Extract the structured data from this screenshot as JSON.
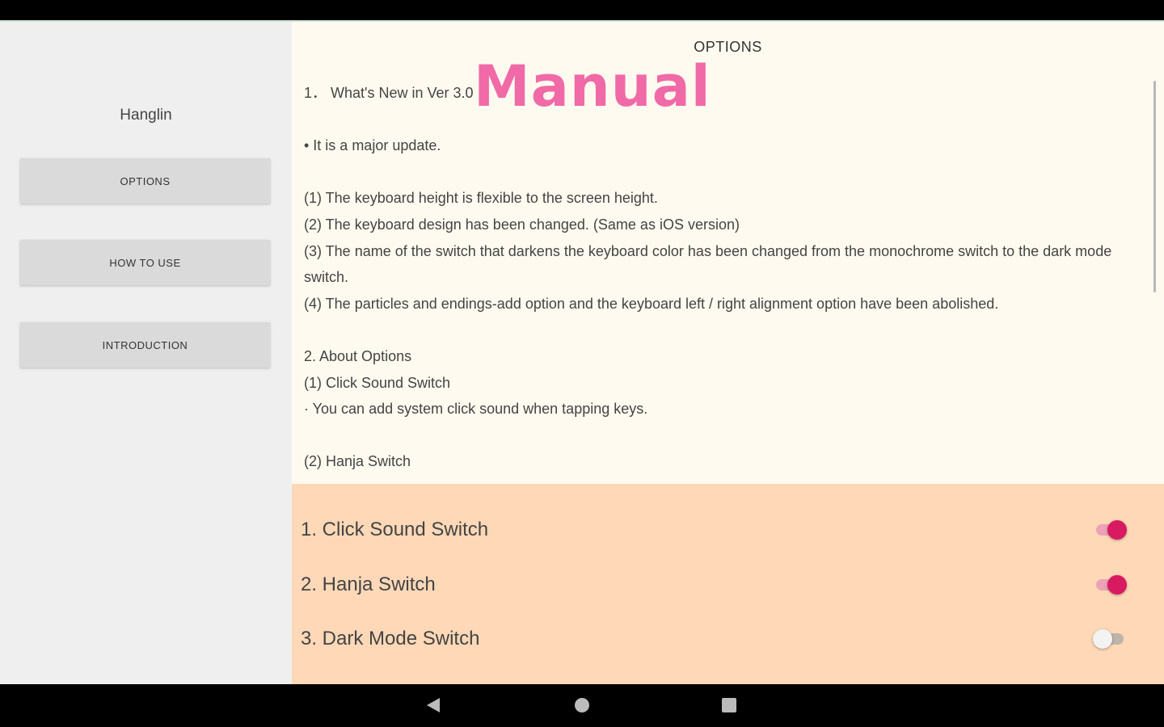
{
  "sidebar": {
    "app_name": "Hanglin",
    "buttons": [
      {
        "label": "OPTIONS"
      },
      {
        "label": "HOW TO USE"
      },
      {
        "label": "INTRODUCTION"
      }
    ]
  },
  "main": {
    "title": "OPTIONS",
    "overlay": "Manual",
    "lines": [
      "1．  What's New in Ver 3.0",
      "",
      " • It is a major update.",
      "",
      "(1) The keyboard height is flexible to the screen height.",
      "(2) The keyboard design has been changed. (Same as iOS version)",
      "(3) The name of the switch that darkens the keyboard color has been changed from the monochrome switch to the dark mode switch.",
      "(4) The particles and endings-add option and the keyboard left / right alignment option have been abolished.",
      "",
      "2. About Options",
      "(1) Click Sound Switch",
      "· You can add system click sound when tapping keys.",
      "",
      "(2) Hanja Switch"
    ]
  },
  "settings": [
    {
      "label": "1. Click Sound Switch",
      "on": true
    },
    {
      "label": "2. Hanja Switch",
      "on": true
    },
    {
      "label": "3. Dark Mode Switch",
      "on": false
    }
  ],
  "colors": {
    "accent": "#d81b60",
    "sidebar_bg": "#efefef",
    "content_bg": "#fffaf0",
    "settings_bg": "#ffd8b7",
    "overlay": "#f06aa8"
  },
  "nav": {
    "back_icon": "back-triangle-icon",
    "home_icon": "home-circle-icon",
    "recent_icon": "recents-square-icon"
  }
}
